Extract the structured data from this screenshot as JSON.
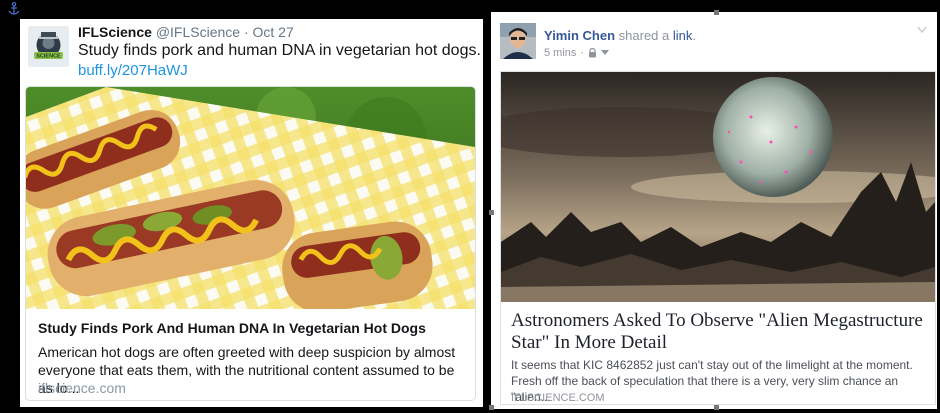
{
  "tweet": {
    "display_name": "IFLScience",
    "handle": "@IFLScience",
    "separator": "·",
    "date": "Oct 27",
    "text": "Study finds pork and human DNA in vegetarian hot dogs.",
    "link": "buff.ly/207HaWJ",
    "avatar_logo_text": "SCIENCE",
    "card": {
      "title": "Study Finds Pork And Human DNA In Vegetarian Hot Dogs",
      "description": "American hot dogs are often greeted with deep suspicion by almost everyone that eats them, with the nutritional content assumed to be as lo...",
      "domain": "iflscience.com"
    }
  },
  "facebook_post": {
    "author": "Yimin Chen",
    "action_text": "shared a",
    "link_word": "link",
    "period": ".",
    "time": "5 mins",
    "meta_separator": "·",
    "privacy_icon": "lock-icon",
    "card": {
      "title": "Astronomers Asked To Observe \"Alien Megastructure Star\" In More Detail",
      "description": "It seems that KIC 8462852 just can't stay out of the limelight at the moment. Fresh off the back of speculation that there is a very, very slim chance an \"alien...",
      "domain": "IFLSCIENCE.COM"
    }
  },
  "colors": {
    "twitter_link": "#1b95e0",
    "facebook_link": "#365899",
    "background": "#000000"
  }
}
